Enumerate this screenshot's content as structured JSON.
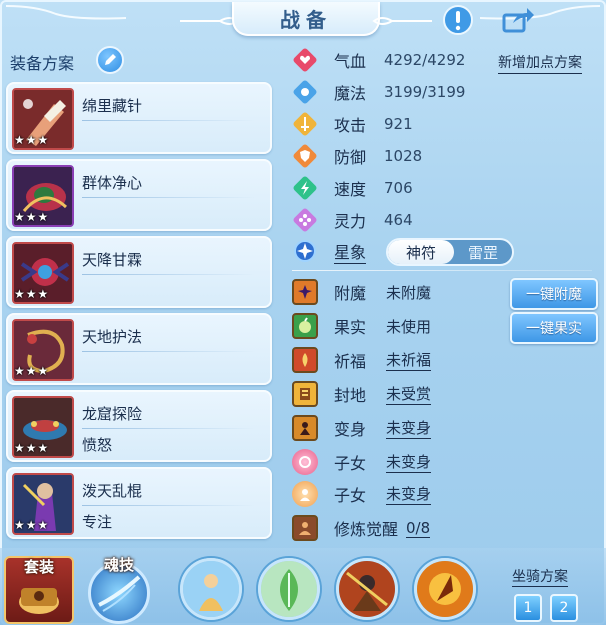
{
  "title": "战备",
  "header": {
    "warn_icon": "exclamation-icon",
    "share_icon": "share-icon"
  },
  "equip_scheme": {
    "label": "装备方案",
    "cards": [
      {
        "name": "绵里藏针",
        "sub": "",
        "stars": "★★★"
      },
      {
        "name": "群体净心",
        "sub": "",
        "stars": "★★★"
      },
      {
        "name": "天降甘霖",
        "sub": "",
        "stars": "★★★"
      },
      {
        "name": "天地护法",
        "sub": "",
        "stars": "★★★"
      },
      {
        "name": "龙窟探险",
        "sub": "愤怒",
        "stars": "★★★"
      },
      {
        "name": "泼天乱棍",
        "sub": "专注",
        "stars": "★★★"
      }
    ]
  },
  "stats": {
    "add_plan": "新增加点方案",
    "items": [
      {
        "label": "气血",
        "value": "4292/4292",
        "color": "#e84a6a"
      },
      {
        "label": "魔法",
        "value": "3199/3199",
        "color": "#4aa3e8"
      },
      {
        "label": "攻击",
        "value": "921",
        "color": "#f0b43a"
      },
      {
        "label": "防御",
        "value": "1028",
        "color": "#f08a3a"
      },
      {
        "label": "速度",
        "value": "706",
        "color": "#2ec28a"
      },
      {
        "label": "灵力",
        "value": "464",
        "color": "#c87ae0"
      }
    ]
  },
  "star_sign": {
    "label": "星象",
    "options": [
      "神符",
      "雷罡"
    ],
    "selected": "神符"
  },
  "attributes": [
    {
      "label": "附魔",
      "value": "未附魔",
      "underline": false
    },
    {
      "label": "果实",
      "value": "未使用",
      "underline": false
    },
    {
      "label": "祈福",
      "value": "未祈福",
      "underline": true
    },
    {
      "label": "封地",
      "value": "未受赏",
      "underline": true
    },
    {
      "label": "变身",
      "value": "未变身",
      "underline": true
    },
    {
      "label": "子女",
      "value": "未变身",
      "underline": true
    },
    {
      "label": "子女",
      "value": "未变身",
      "underline": true
    },
    {
      "label": "修炼觉醒",
      "value": "0/8",
      "underline": true
    }
  ],
  "buttons": {
    "enchant": "一键附魔",
    "fruit": "一键果实"
  },
  "bottom": {
    "set_label": "套装",
    "soul_label": "魂技",
    "mount_label": "坐骑方案",
    "mount_options": [
      "1",
      "2"
    ]
  }
}
